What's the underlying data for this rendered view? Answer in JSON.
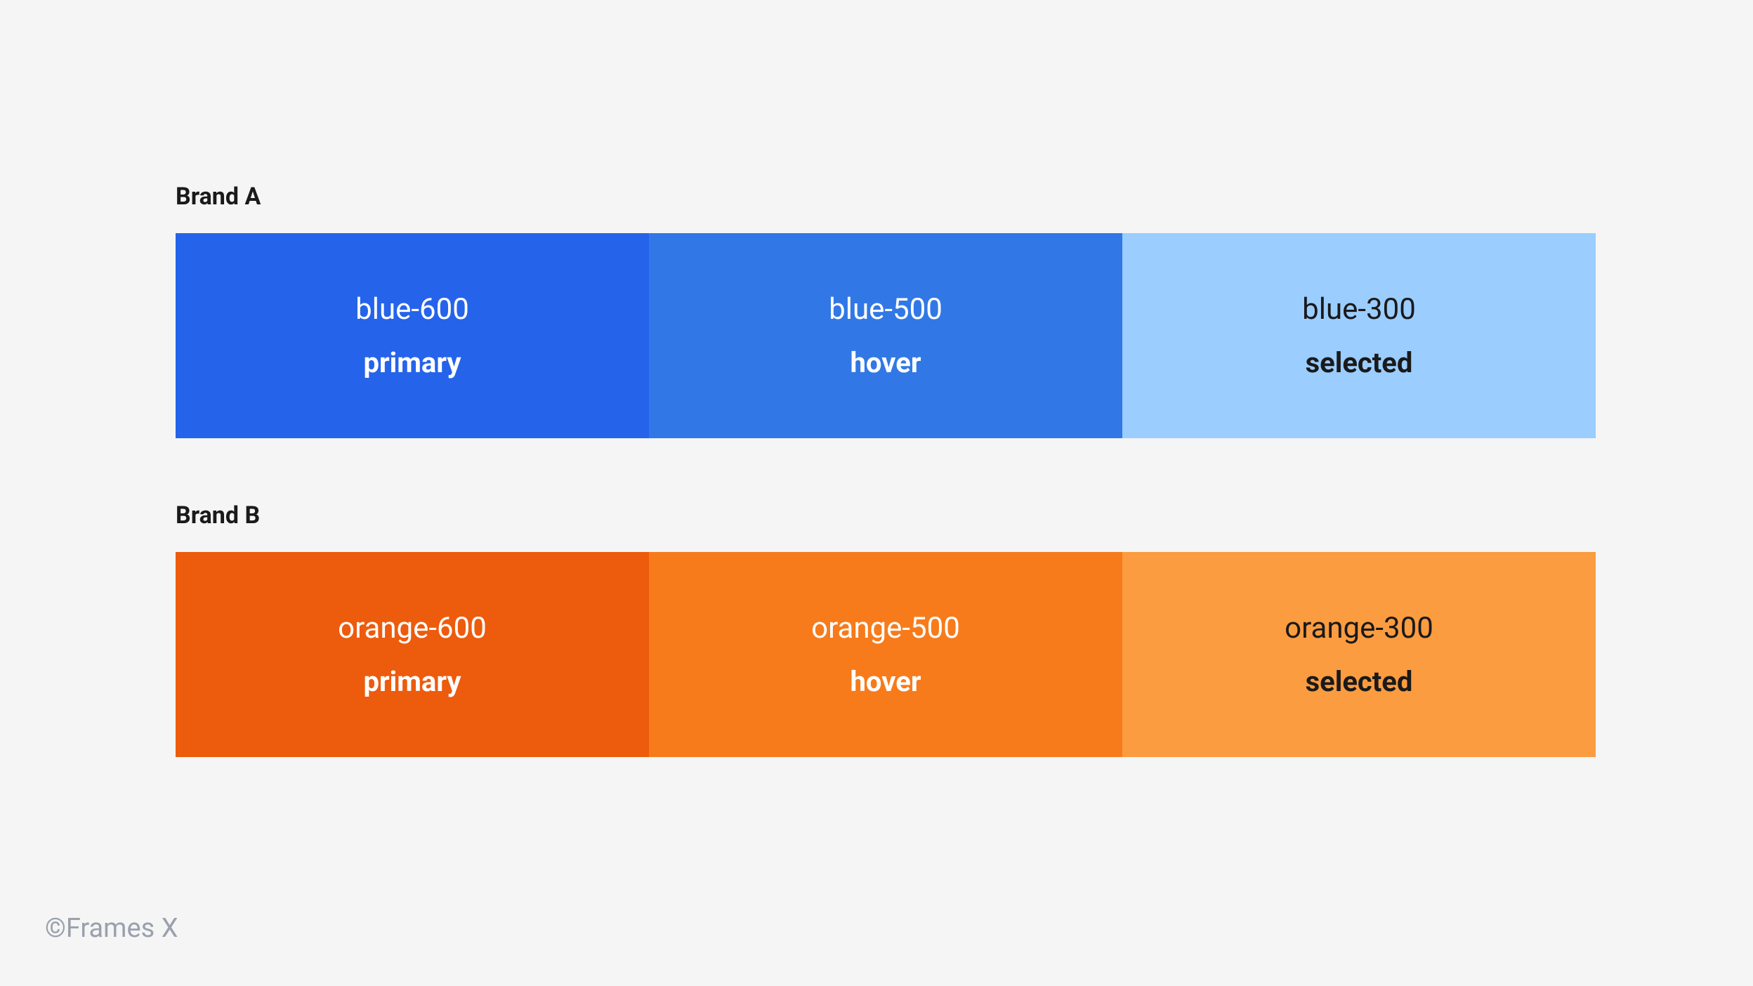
{
  "brands": [
    {
      "title": "Brand A",
      "swatches": [
        {
          "name": "blue-600",
          "role": "primary",
          "bg": "#2563eb",
          "text": "light"
        },
        {
          "name": "blue-500",
          "role": "hover",
          "bg": "#3178e6",
          "text": "light"
        },
        {
          "name": "blue-300",
          "role": "selected",
          "bg": "#9bcdff",
          "text": "dark"
        }
      ]
    },
    {
      "title": "Brand B",
      "swatches": [
        {
          "name": "orange-600",
          "role": "primary",
          "bg": "#ed5b0d",
          "text": "light"
        },
        {
          "name": "orange-500",
          "role": "hover",
          "bg": "#f77b1b",
          "text": "light"
        },
        {
          "name": "orange-300",
          "role": "selected",
          "bg": "#fb9c40",
          "text": "dark"
        }
      ]
    }
  ],
  "footer": "©Frames X"
}
